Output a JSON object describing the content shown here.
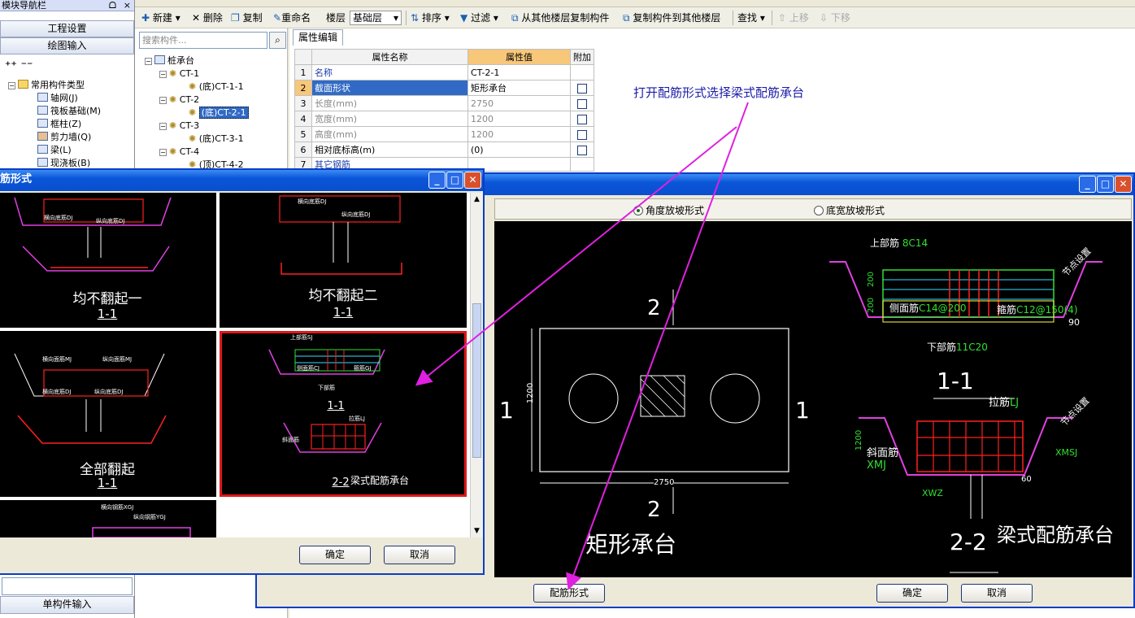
{
  "nav": {
    "title": "模块导航栏",
    "pin_icon": "pin-icon",
    "close_label": "×",
    "btn_project": "工程设置",
    "btn_draw": "绘图输入",
    "btn_single": "单构件输入",
    "group_label": "常用构件类型",
    "items": [
      "轴网(J)",
      "筏板基础(M)",
      "框柱(Z)",
      "剪力墙(Q)",
      "梁(L)",
      "现浇板(B)"
    ]
  },
  "toolbar": {
    "new": "新建",
    "delete": "删除",
    "copy": "复制",
    "rename": "重命名",
    "floor_label": "楼层",
    "floor_value": "基础层",
    "sort": "排序",
    "filter": "过滤",
    "copy_from": "从其他楼层复制构件",
    "copy_to": "复制构件到其他楼层",
    "find": "查找",
    "up": "上移",
    "down": "下移"
  },
  "tree": {
    "search_placeholder": "搜索构件...",
    "root": "桩承台",
    "nodes": [
      {
        "name": "CT-1",
        "child": "(底)CT-1-1"
      },
      {
        "name": "CT-2",
        "child": "(底)CT-2-1"
      },
      {
        "name": "CT-3",
        "child": "(底)CT-3-1"
      },
      {
        "name": "CT-4",
        "child": "(顶)CT-4-2"
      }
    ]
  },
  "props": {
    "tab": "属性编辑",
    "h_name": "属性名称",
    "h_value": "属性值",
    "h_add": "附加",
    "rows": [
      {
        "n": "1",
        "name": "名称",
        "value": "CT-2-1"
      },
      {
        "n": "2",
        "name": "截面形状",
        "value": "矩形承台"
      },
      {
        "n": "3",
        "name": "长度(mm)",
        "value": "2750"
      },
      {
        "n": "4",
        "name": "宽度(mm)",
        "value": "1200"
      },
      {
        "n": "5",
        "name": "高度(mm)",
        "value": "1200"
      },
      {
        "n": "6",
        "name": "相对底标高(m)",
        "value": "(0)"
      },
      {
        "n": "7",
        "name": "其它钢筋",
        "value": ""
      }
    ]
  },
  "annotation": "打开配筋形式选择梁式配筋承台",
  "accent_annotation_color": "#e020e0",
  "dlg_small": {
    "title": "筋形式",
    "ok": "确定",
    "cancel": "取消",
    "thumbs": [
      {
        "caption": "均不翻起一",
        "section": "1-1"
      },
      {
        "caption": "均不翻起二",
        "section": "1-1"
      },
      {
        "caption": "全部翻起",
        "section": "1-1"
      },
      {
        "caption": "梁式配筋承台",
        "section_a": "1-1",
        "section_b": "2-2"
      }
    ],
    "thumb_labels": {
      "t1": [
        "横向底筋DJ",
        "纵向底筋DJ"
      ],
      "t2": [
        "横向底筋DJ",
        "纵向底筋DJ"
      ],
      "t3": [
        "横向面筋MJ",
        "纵向面筋MJ",
        "横向底筋DJ",
        "纵向底筋DJ"
      ],
      "t4": [
        "上部筋SJ",
        "侧面筋CJ",
        "箍筋GJ",
        "下部筋",
        "拉筋LJ",
        "斜面筋"
      ],
      "t5": [
        "横向钢筋XGJ",
        "纵向钢筋YGJ"
      ]
    }
  },
  "dlg_big": {
    "radio_angle": "角度放坡形式",
    "radio_bottom": "底宽放坡形式",
    "btn_rebar": "配筋形式",
    "ok": "确定",
    "cancel": "取消",
    "cad": {
      "sec2_top": "2",
      "sec2_bot": "2",
      "sec1_left": "1",
      "sec1_right": "1",
      "dim_h": "1200",
      "dim_w": "2750",
      "caption_rect": "矩形承台",
      "top_bar": "上部筋",
      "top_bar_val": "8C14",
      "side_bar": "侧面筋",
      "side_bar_val": "C14@200",
      "stirrup": "箍筋",
      "stirrup_val": "C12@150(4)",
      "bottom_bar": "下部筋",
      "bottom_bar_val": "11C20",
      "dim200a": "200",
      "dim200b": "200",
      "angle": "90",
      "sec11": "1-1",
      "sec22": "2-2",
      "tie": "拉筋",
      "tie_val": "LJ",
      "slope": "斜面筋",
      "slope_val": "XMJ",
      "xmsj": "XMSJ",
      "xwz": "XWZ",
      "dim60": "60",
      "dim1200b": "1200",
      "note": "节点设置",
      "caption_beam": "梁式配筋承台"
    }
  }
}
